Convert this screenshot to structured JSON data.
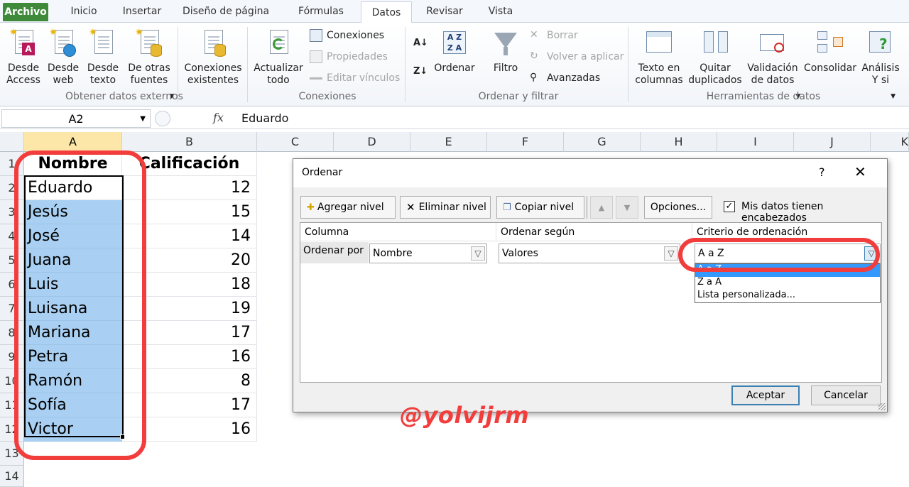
{
  "ribbon_tabs": [
    "Archivo",
    "Inicio",
    "Insertar",
    "Diseño de página",
    "Fórmulas",
    "Datos",
    "Revisar",
    "Vista"
  ],
  "ribbon": {
    "get_external": {
      "access": "Desde\nAccess",
      "web": "Desde\nweb",
      "text": "Desde\ntexto",
      "other": "De otras\nfuentes",
      "existing": "Conexiones\nexistentes",
      "group_label": "Obtener datos externos"
    },
    "connections": {
      "refresh": "Actualizar\ntodo",
      "connections": "Conexiones",
      "properties": "Propiedades",
      "edit_links": "Editar vínculos",
      "group_label": "Conexiones"
    },
    "sort_filter": {
      "sort": "Ordenar",
      "filter": "Filtro",
      "clear": "Borrar",
      "reapply": "Volver a aplicar",
      "advanced": "Avanzadas",
      "group_label": "Ordenar y filtrar"
    },
    "data_tools": {
      "text_to_columns": "Texto en\ncolumnas",
      "remove_duplicates": "Quitar\nduplicados",
      "validation": "Validación\nde datos",
      "consolidate": "Consolidar",
      "whatif": "Análisis\nY si",
      "group_label": "Herramientas de datos"
    }
  },
  "formula_bar": {
    "name_box": "A2",
    "fx": "fx",
    "value": "Eduardo"
  },
  "grid": {
    "columns": [
      "A",
      "B",
      "C",
      "D",
      "E",
      "F",
      "G",
      "H",
      "I",
      "J",
      "K"
    ],
    "rows": [
      "1",
      "2",
      "3",
      "4",
      "5",
      "6",
      "7",
      "8",
      "9",
      "10",
      "11",
      "12",
      "13",
      "14"
    ],
    "headers": {
      "name": "Nombre",
      "grade": "Calificación"
    },
    "data": [
      {
        "name": "Eduardo",
        "grade": "12"
      },
      {
        "name": "Jesús",
        "grade": "15"
      },
      {
        "name": "José",
        "grade": "14"
      },
      {
        "name": "Juana",
        "grade": "20"
      },
      {
        "name": "Luis",
        "grade": "18"
      },
      {
        "name": "Luisana",
        "grade": "19"
      },
      {
        "name": "Mariana",
        "grade": "17"
      },
      {
        "name": "Petra",
        "grade": "16"
      },
      {
        "name": "Ramón",
        "grade": "8"
      },
      {
        "name": "Sofía",
        "grade": "17"
      },
      {
        "name": "Victor",
        "grade": "16"
      }
    ]
  },
  "dialog": {
    "title": "Ordenar",
    "help": "?",
    "close": "✕",
    "add_level": "Agregar nivel",
    "delete_level": "Eliminar nivel",
    "copy_level": "Copiar nivel",
    "options": "Opciones...",
    "has_headers_label": "Mis datos tienen encabezados",
    "has_headers_checked": true,
    "col_headers": {
      "column": "Columna",
      "sort_on": "Ordenar según",
      "order": "Criterio de ordenación"
    },
    "row": {
      "label": "Ordenar por",
      "column": "Nombre",
      "sort_on": "Valores",
      "order": "A a Z"
    },
    "order_options": [
      "A a Z",
      "Z a A",
      "Lista personalizada..."
    ],
    "ok": "Aceptar",
    "cancel": "Cancelar"
  },
  "watermark": "@yolvijrm",
  "colors": {
    "accent_red": "#f23d3d",
    "file_tab": "#3f8a3a",
    "selection_fill": "#a9d0f2"
  }
}
